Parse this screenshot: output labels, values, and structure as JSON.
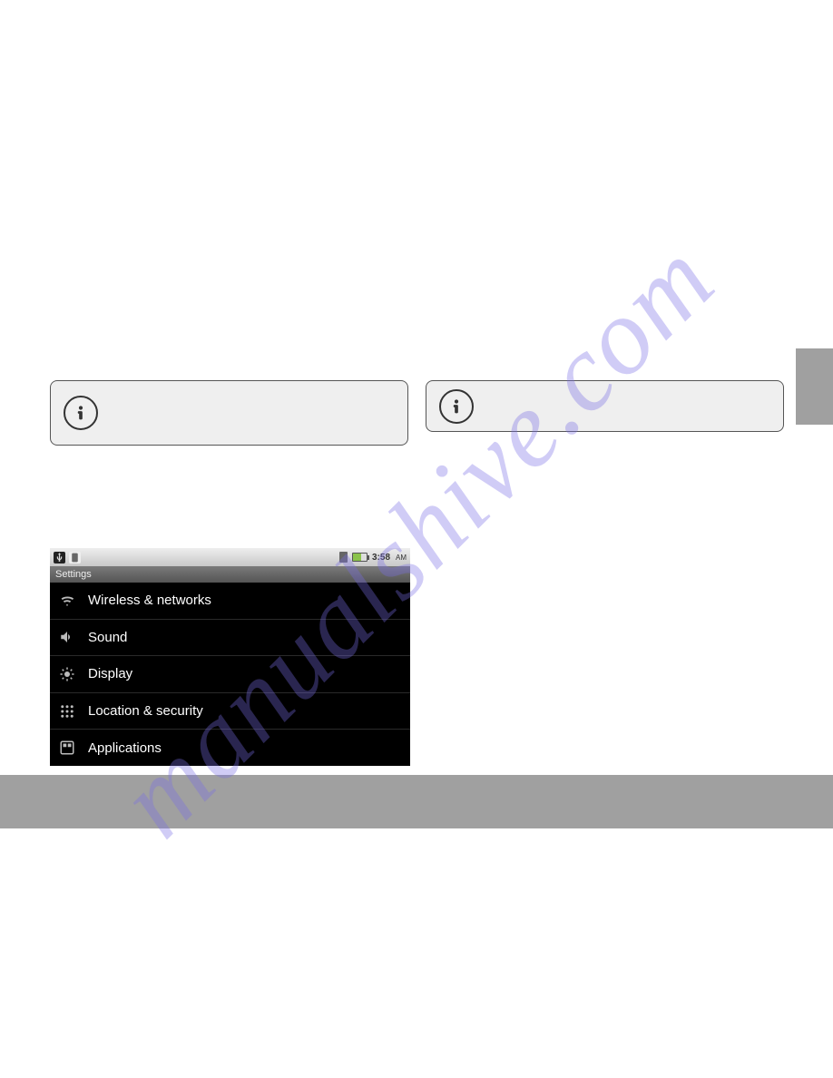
{
  "watermark": "manualshive.com",
  "status_bar": {
    "time": "3:58",
    "ampm": "AM"
  },
  "settings": {
    "header": "Settings",
    "items": [
      {
        "label": "Wireless & networks"
      },
      {
        "label": "Sound"
      },
      {
        "label": "Display"
      },
      {
        "label": "Location & security"
      },
      {
        "label": "Applications"
      }
    ]
  }
}
